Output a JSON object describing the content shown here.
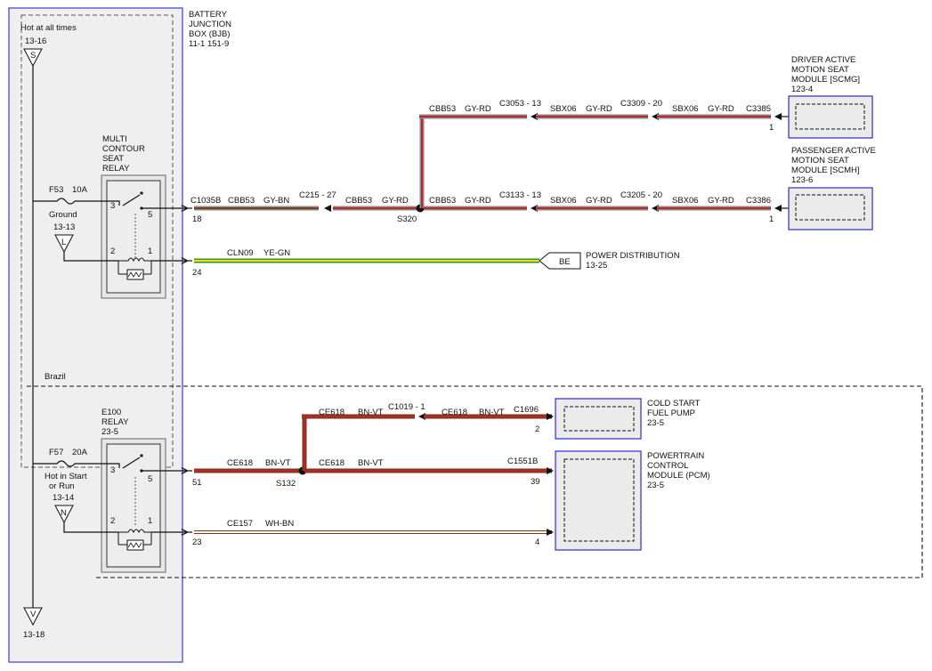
{
  "bjb": {
    "title_lines": [
      "BATTERY",
      "JUNCTION",
      "BOX (BJB)"
    ],
    "refs": "11-1   151-9"
  },
  "power_in": {
    "label": "Hot at all times",
    "ref": "13-16",
    "symbol": "S"
  },
  "ground_out": {
    "symbol": "V",
    "ref": "13-18"
  },
  "relay1": {
    "title_lines": [
      "MULTI",
      "CONTOUR",
      "SEAT",
      "RELAY"
    ],
    "pin_3": "3",
    "pin_5": "5",
    "pin_2": "2",
    "pin_1": "1"
  },
  "fuse1": {
    "name": "F53",
    "rating": "10A"
  },
  "ground1": {
    "label": "Ground",
    "ref": "13-13",
    "symbol": "L"
  },
  "relay2": {
    "title_lines": [
      "E100",
      "RELAY"
    ],
    "ref": "23-5",
    "pin_3": "3",
    "pin_5": "5",
    "pin_2": "2",
    "pin_1": "1"
  },
  "fuse2": {
    "name": "F57",
    "rating": "20A"
  },
  "ignition": {
    "label_lines": [
      "Hot in Start",
      "or Run"
    ],
    "ref": "13-14",
    "symbol": "N"
  },
  "brazil_label": "Brazil",
  "upper_circuit": {
    "bjb_connector": "C1035B",
    "bjb_pin": "18",
    "seg1": {
      "circuit": "CBB53",
      "color": "GY-BN"
    },
    "inline_connector": "C215 - 27",
    "seg2": {
      "circuit": "CBB53",
      "color": "GY-RD"
    },
    "splice": "S320",
    "branch_top": {
      "seg_a": {
        "circuit": "CBB53",
        "color": "GY-RD"
      },
      "connector_a": "C3053 - 13",
      "seg_b": {
        "circuit": "SBX06",
        "color": "GY-RD"
      },
      "connector_b": "C3309 - 20",
      "seg_c": {
        "circuit": "SBX06",
        "color": "GY-RD"
      },
      "end_connector": "C3385",
      "end_pin": "1"
    },
    "branch_bottom": {
      "seg_a": {
        "circuit": "CBB53",
        "color": "GY-RD"
      },
      "connector_a": "C3133 - 13",
      "seg_b": {
        "circuit": "SBX06",
        "color": "GY-RD"
      },
      "connector_b": "C3205 - 20",
      "seg_c": {
        "circuit": "SBX06",
        "color": "GY-RD"
      },
      "end_connector": "C3386",
      "end_pin": "1"
    }
  },
  "module_driver": {
    "title_lines": [
      "DRIVER ACTIVE",
      "MOTION SEAT",
      "MODULE [SCMG]"
    ],
    "ref": "123-4"
  },
  "module_passenger": {
    "title_lines": [
      "PASSENGER ACTIVE",
      "MOTION SEAT",
      "MODULE [SCMH]"
    ],
    "ref": "123-6"
  },
  "power_dist_wire": {
    "circuit": "CLN09",
    "color": "YE-GN",
    "bjb_pin": "24",
    "tag": "BE",
    "dest": "POWER DISTRIBUTION",
    "dest_ref": "13-25"
  },
  "lower_circuit": {
    "bjb_pin": "51",
    "seg1": {
      "circuit": "CE618",
      "color": "BN-VT"
    },
    "splice": "S132",
    "seg2": {
      "circuit": "CE618",
      "color": "BN-VT"
    },
    "pcm_connector": "C1551B",
    "pcm_pin": "39",
    "branch_up": {
      "circuit": "CE618",
      "color": "BN-VT"
    },
    "inline_connector": "C1019 - 1",
    "branch_seg": {
      "circuit": "CE618",
      "color": "BN-VT"
    },
    "pump_connector": "C1696",
    "pump_pin": "2"
  },
  "lower_wire2": {
    "circuit": "CE157",
    "color": "WH-BN",
    "bjb_pin": "23",
    "pcm_pin": "4"
  },
  "fuel_pump": {
    "title_lines": [
      "COLD START",
      "FUEL PUMP"
    ],
    "ref": "23-5"
  },
  "pcm": {
    "title_lines": [
      "POWERTRAIN",
      "CONTROL",
      "MODULE (PCM)"
    ],
    "ref": "23-5"
  },
  "colors": {
    "wire_gy": "#8a8a8a",
    "wire_rd": "#c0242a",
    "wire_ye": "#e8e41c",
    "wire_gn": "#3c8e2a",
    "wire_bn": "#7a3a1c",
    "wire_vt": "#8c3aa8",
    "wire_wh": "#ffffff",
    "bjb_border": "#3b3bd6"
  }
}
